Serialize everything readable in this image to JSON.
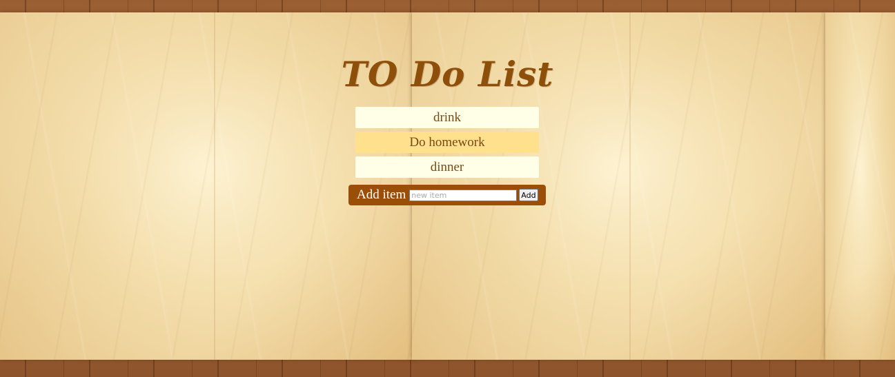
{
  "app": {
    "title": "TO Do List"
  },
  "todos": [
    {
      "label": "drink",
      "highlighted": false
    },
    {
      "label": "Do homework",
      "highlighted": true
    },
    {
      "label": "dinner",
      "highlighted": false
    }
  ],
  "add_form": {
    "label": "Add item",
    "input_value": "",
    "input_placeholder": "new item",
    "button_label": "Add"
  },
  "colors": {
    "title": "#8e4f0a",
    "item_bg": "#fffee6",
    "item_highlight_bg": "#ffe08c",
    "add_bar_bg": "#9a4e07"
  }
}
